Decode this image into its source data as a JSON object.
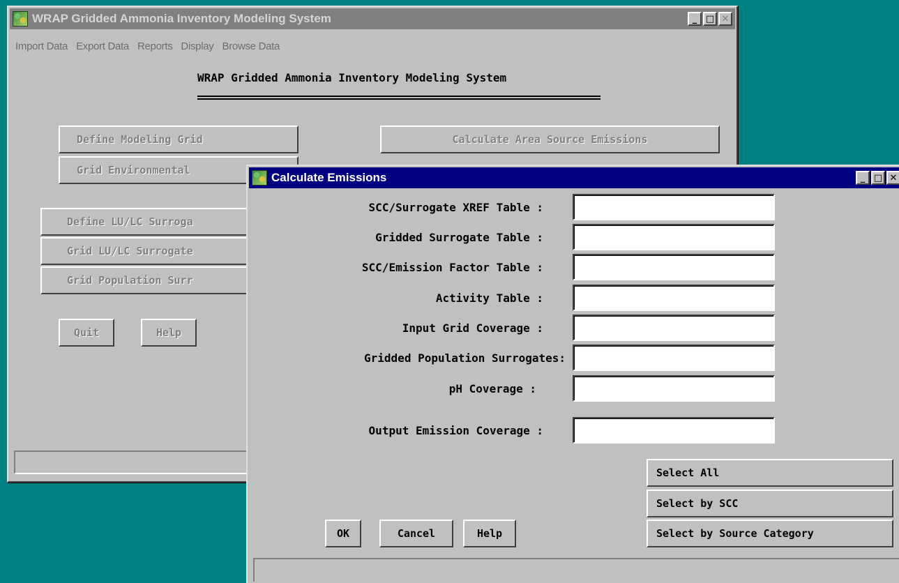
{
  "main_window": {
    "title": "WRAP Gridded Ammonia Inventory Modeling System",
    "menu": [
      "Import Data",
      "Export Data",
      "Reports",
      "Display",
      "Browse Data"
    ],
    "heading": "WRAP Gridded Ammonia Inventory Modeling System",
    "buttons": {
      "define_modeling_grid": "Define Modeling Grid",
      "calc_area_source": "Calculate Area Source Emissions",
      "grid_environmental": "Grid Environmental",
      "define_lulc": "Define LU/LC Surroga",
      "grid_lulc": "Grid LU/LC Surrogate",
      "grid_population": "Grid Population Surr",
      "quit": "Quit",
      "help": "Help"
    }
  },
  "dialog": {
    "title": "Calculate Emissions",
    "fields": [
      {
        "label": "SCC/Surrogate XREF Table :",
        "value": ""
      },
      {
        "label": "Gridded Surrogate Table :",
        "value": ""
      },
      {
        "label": "SCC/Emission Factor Table :",
        "value": ""
      },
      {
        "label": "Activity Table :",
        "value": ""
      },
      {
        "label": "Input Grid Coverage :",
        "value": ""
      },
      {
        "label": "Gridded Population Surrogates:",
        "value": ""
      },
      {
        "label": "pH Coverage :",
        "value": ""
      },
      {
        "label": "Output Emission Coverage :",
        "value": ""
      }
    ],
    "buttons": {
      "ok": "OK",
      "cancel": "Cancel",
      "help": "Help",
      "select_all": "Select All",
      "select_by_scc": "Select by SCC",
      "select_by_source_category": "Select by Source Category"
    }
  },
  "titlebar_glyphs": {
    "minimize": "_",
    "maximize": "□",
    "close": "✕"
  }
}
